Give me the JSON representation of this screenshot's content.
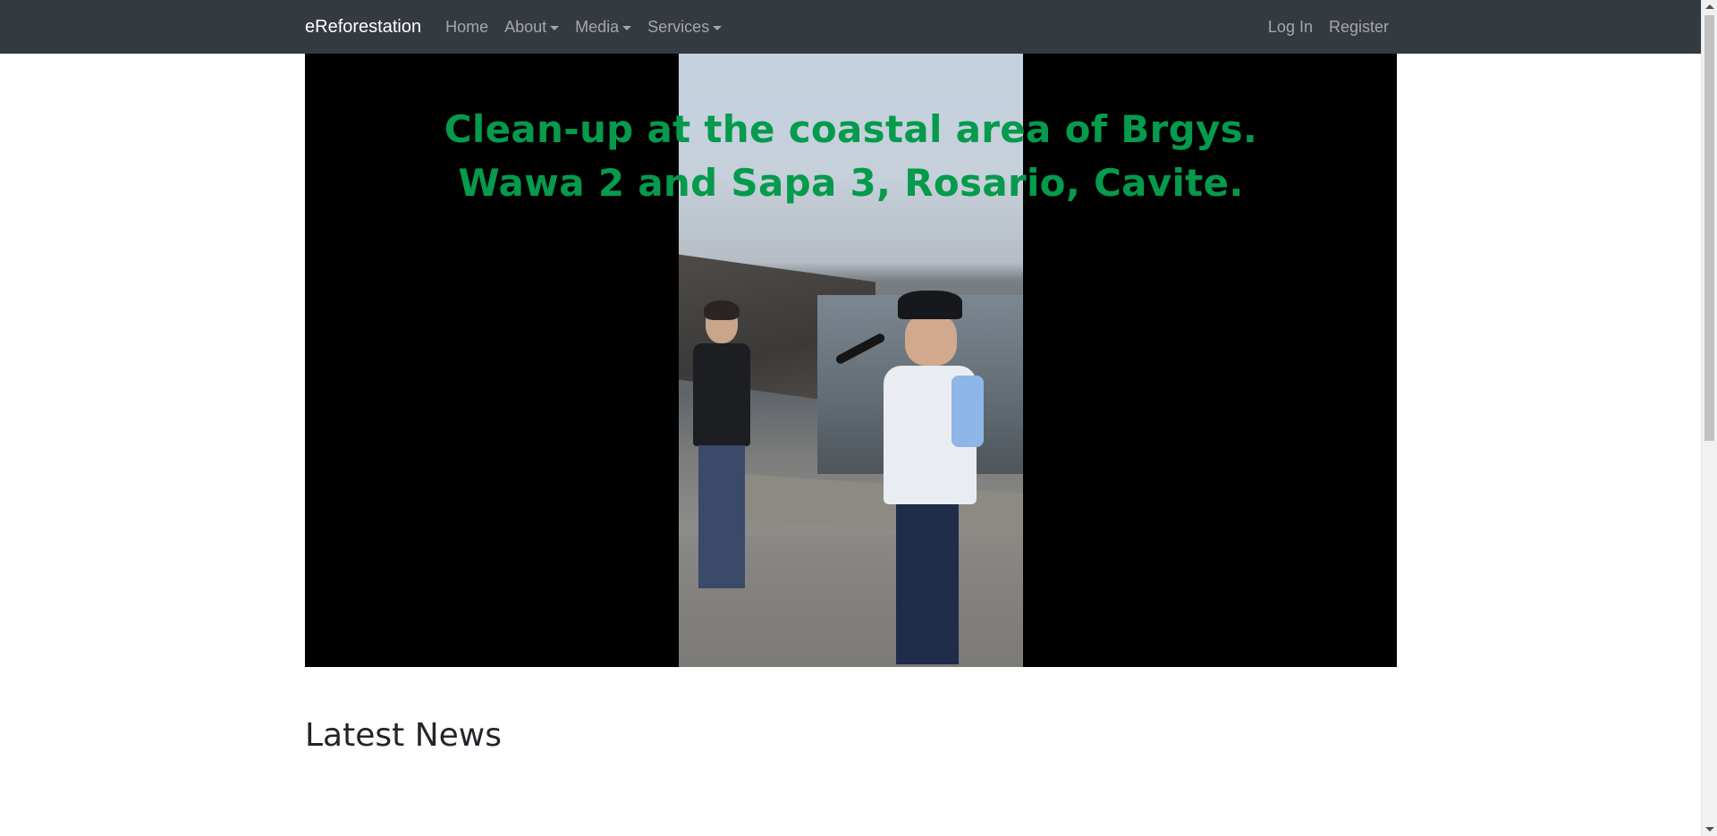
{
  "navbar": {
    "brand": "eReforestation",
    "links": [
      {
        "label": "Home",
        "dropdown": false
      },
      {
        "label": "About",
        "dropdown": true
      },
      {
        "label": "Media",
        "dropdown": true
      },
      {
        "label": "Services",
        "dropdown": true
      }
    ],
    "right_links": [
      {
        "label": "Log In"
      },
      {
        "label": "Register"
      }
    ]
  },
  "video": {
    "caption_lines": [
      "Clean-up at the coastal area of Brgys.",
      "Wawa 2 and Sapa 3, Rosario, Cavite."
    ],
    "caption_color": "#069a4c"
  },
  "main": {
    "news_heading": "Latest News"
  },
  "colors": {
    "navbar_bg": "#343a40",
    "page_bg": "#ffffff",
    "video_bg": "#000000"
  }
}
